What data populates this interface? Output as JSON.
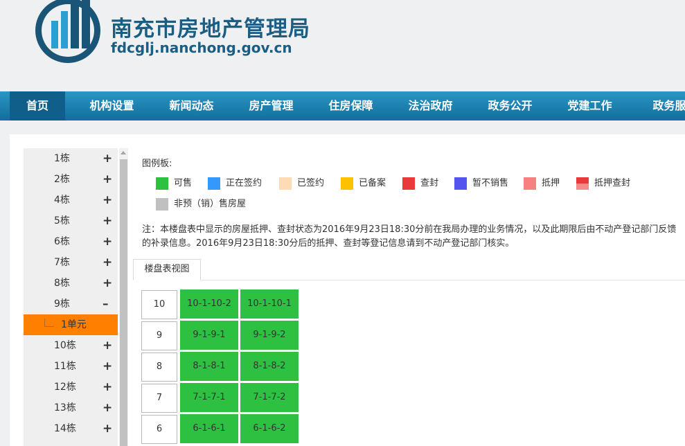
{
  "header": {
    "title": "南充市房地产管理局",
    "domain": "fdcglj.nanchong.gov.cn"
  },
  "nav": {
    "items": [
      "首页",
      "机构设置",
      "新闻动态",
      "房产管理",
      "住房保障",
      "法治政府",
      "政务公开",
      "党建工作",
      "政务服"
    ]
  },
  "sidebar": {
    "items": [
      {
        "label": "1栋",
        "sign": "+"
      },
      {
        "label": "2栋",
        "sign": "+"
      },
      {
        "label": "4栋",
        "sign": "+"
      },
      {
        "label": "5栋",
        "sign": "+"
      },
      {
        "label": "6栋",
        "sign": "+"
      },
      {
        "label": "7栋",
        "sign": "+"
      },
      {
        "label": "8栋",
        "sign": "+"
      },
      {
        "label": "9栋",
        "sign": "–"
      }
    ],
    "selected_sub": "1单元",
    "items_after": [
      {
        "label": "10栋",
        "sign": "+"
      },
      {
        "label": "11栋",
        "sign": "+"
      },
      {
        "label": "12栋",
        "sign": "+"
      },
      {
        "label": "13栋",
        "sign": "+"
      },
      {
        "label": "14栋",
        "sign": "+"
      }
    ]
  },
  "legend": {
    "title": "图例板:",
    "items": [
      {
        "label": "可售",
        "color": "#2dc041"
      },
      {
        "label": "正在签约",
        "color": "#3399ff"
      },
      {
        "label": "已签约",
        "color": "#ffdbb5"
      },
      {
        "label": "已备案",
        "color": "#ffc000"
      },
      {
        "label": "查封",
        "color": "#e83a3a"
      },
      {
        "label": "暂不销售",
        "color": "#5555ee"
      },
      {
        "label": "抵押",
        "color": "#f78080"
      },
      {
        "label": "抵押查封",
        "color": "#e83a3a/#f78a8a"
      },
      {
        "label": "非预（销）售房屋",
        "color": "#c0c0c0"
      }
    ]
  },
  "note": "注：本楼盘表中显示的房屋抵押、查封状态为2016年9月23日18:30分前在我局办理的业务情况，以及此期限后由不动产登记部门反馈的补录信息。2016年9月23日18:30分后的抵押、查封等登记信息请到不动产登记部门核实。",
  "tab": {
    "label": "楼盘表视图"
  },
  "floors": [
    {
      "floor": "10",
      "units": [
        "10-1-10-2",
        "10-1-10-1"
      ]
    },
    {
      "floor": "9",
      "units": [
        "9-1-9-1",
        "9-1-9-2"
      ]
    },
    {
      "floor": "8",
      "units": [
        "8-1-8-1",
        "8-1-8-2"
      ]
    },
    {
      "floor": "7",
      "units": [
        "7-1-7-1",
        "7-1-7-2"
      ]
    },
    {
      "floor": "6",
      "units": [
        "6-1-6-1",
        "6-1-6-2"
      ]
    }
  ]
}
